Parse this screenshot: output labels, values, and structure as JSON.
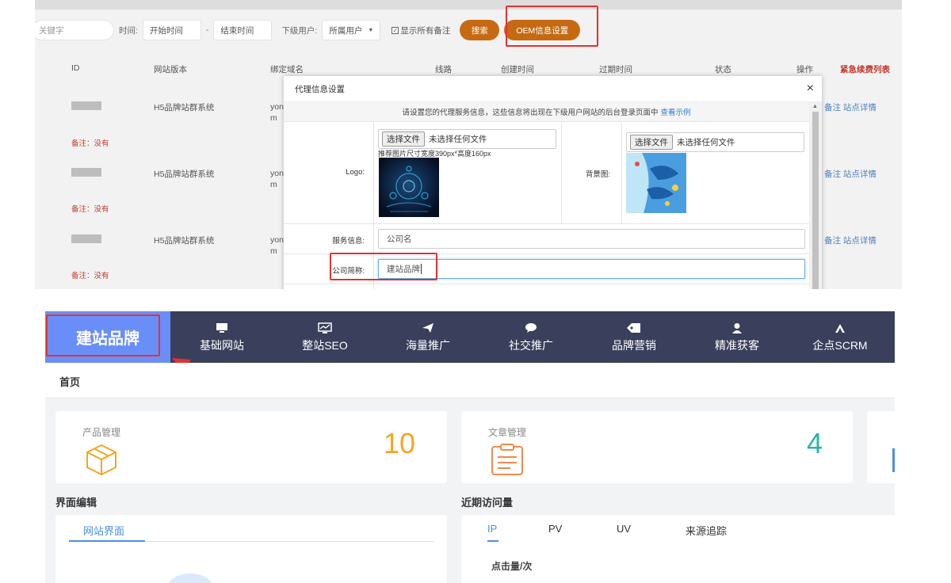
{
  "filter": {
    "keyword_placeholder": "关键字",
    "time_label": "时间:",
    "start_placeholder": "开始时间",
    "dash": "-",
    "end_placeholder": "结束时间",
    "sub_user_label": "下级用户:",
    "sub_user_value": "所属用户",
    "show_notes_label": "显示所有备注",
    "search_button": "搜索",
    "oem_button": "OEM信息设置"
  },
  "table": {
    "headers": {
      "id": "ID",
      "version": "网站版本",
      "domain": "绑定域名",
      "line": "线路",
      "created": "创建时间",
      "expires": "过期时间",
      "status": "状态",
      "action": "操作",
      "urgent": "紧急续费列表"
    },
    "rows": [
      {
        "version": "H5品牌站群系统",
        "domain": "yon m",
        "note": "备注：没有",
        "ops": "备注  站点详情"
      },
      {
        "version": "H5品牌站群系统",
        "domain": "yon m",
        "note": "备注：没有",
        "ops": "备注  站点详情"
      },
      {
        "version": "H5品牌站群系统",
        "domain": "yon m",
        "note": "备注：没有",
        "ops": "备注  站点详情"
      }
    ]
  },
  "modal": {
    "title": "代理信息设置",
    "close": "×",
    "notice": "请设置您的代理服务信息，这些信息将出现在下级用户网站的后台登录页面中",
    "notice_link": "查看示例",
    "logo_label": "Logo:",
    "choose_file": "选择文件",
    "no_file": "未选择任何文件",
    "logo_hint": "推荐图片尺寸宽度390px*高度160px",
    "bg_label": "背景图:",
    "service_label": "服务信息:",
    "service_value": "公司名",
    "short_name_label": "公司简称:",
    "short_name_value": "建站品牌"
  },
  "nav": {
    "brand": "建站品牌",
    "items": [
      {
        "label": "基础网站",
        "icon": "monitor-icon"
      },
      {
        "label": "整站SEO",
        "icon": "chart-monitor-icon"
      },
      {
        "label": "海量推广",
        "icon": "paper-plane-icon"
      },
      {
        "label": "社交推广",
        "icon": "chat-bubble-icon"
      },
      {
        "label": "品牌营销",
        "icon": "tag-icon"
      },
      {
        "label": "精准获客",
        "icon": "user-icon"
      },
      {
        "label": "企点SCRM",
        "icon": "a-letter-icon"
      }
    ]
  },
  "dashboard": {
    "breadcrumb": "首页",
    "cards": [
      {
        "title": "产品管理",
        "value": "10",
        "icon": "cube-icon",
        "color": "#f5a623"
      },
      {
        "title": "文章管理",
        "value": "4",
        "icon": "clipboard-icon",
        "color": "#2bb5a4"
      }
    ],
    "ui_edit_title": "界面编辑",
    "ui_edit_tab": "网站界面",
    "visits_title": "近期访问量",
    "visits_tabs": [
      "IP",
      "PV",
      "UV",
      "来源追踪"
    ],
    "clicks_label": "点击量/次"
  },
  "colors": {
    "nav_bg": "#3a3f5c",
    "brand_bg": "#6a8ef7",
    "orange_button": "#c56a12",
    "highlight_red": "#e53030",
    "link_blue": "#4a7fbf"
  }
}
